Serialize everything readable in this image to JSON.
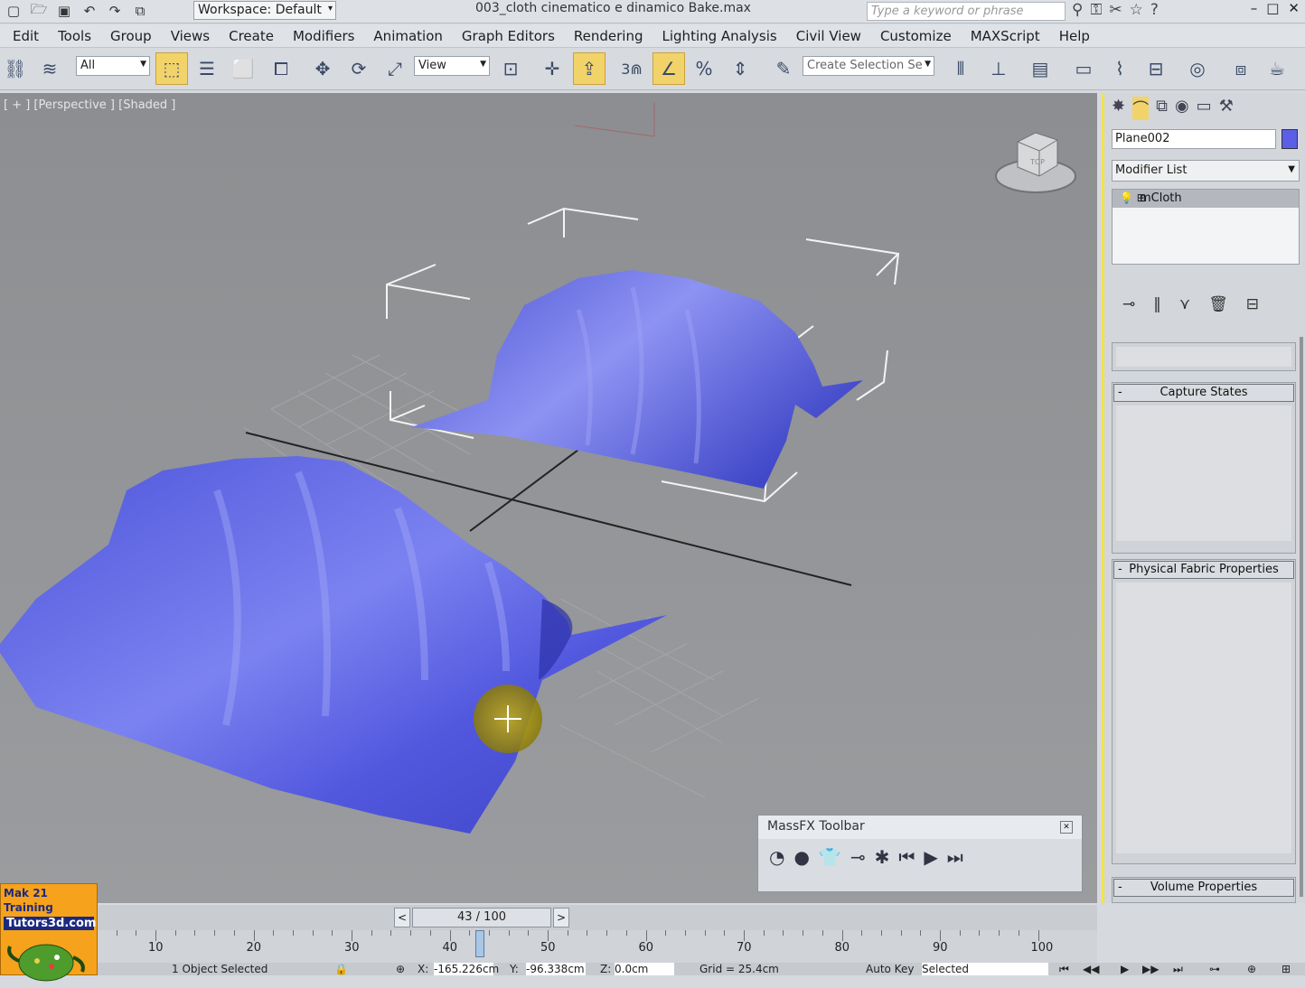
{
  "titlebar": {
    "workspace": "Workspace: Default",
    "title": "003_cloth cinematico e dinamico Bake.max",
    "search_placeholder": "Type a keyword or phrase"
  },
  "menu": [
    "Edit",
    "Tools",
    "Group",
    "Views",
    "Create",
    "Modifiers",
    "Animation",
    "Graph Editors",
    "Rendering",
    "Lighting Analysis",
    "Civil View",
    "Customize",
    "MAXScript",
    "Help"
  ],
  "toolbar": {
    "filter": "All",
    "refcoord": "View",
    "snap_num": "3",
    "selection_set": "Create Selection Se"
  },
  "viewport": {
    "label": "[ + ] [Perspective ] [Shaded ]",
    "cube_label": "TOP"
  },
  "massfx": {
    "title": "MassFX Toolbar"
  },
  "logo": {
    "line1": "Mak 21 Training",
    "line2": "Tutors3d.com"
  },
  "timeslider": {
    "value": "43 / 100",
    "prev": "<",
    "next": ">"
  },
  "track": {
    "ticks": [
      "10",
      "20",
      "30",
      "40",
      "50",
      "60",
      "70",
      "80",
      "90",
      "100"
    ]
  },
  "status": {
    "selected": "1 Object Selected",
    "x": "-165.226cm",
    "y": "-96.338cm",
    "z": "0.0cm",
    "grid": "Grid = 25.4cm",
    "autokey": "Auto Key",
    "selected_combo": "Selected"
  },
  "cmdpanel": {
    "object_name": "Plane002",
    "object_color": "#5b5fe8",
    "modifier_list": "Modifier List",
    "stack_item": "mCloth",
    "rollouts": {
      "capture": "Capture States",
      "physical": "Physical Fabric Properties",
      "volume": "Volume Properties"
    }
  }
}
